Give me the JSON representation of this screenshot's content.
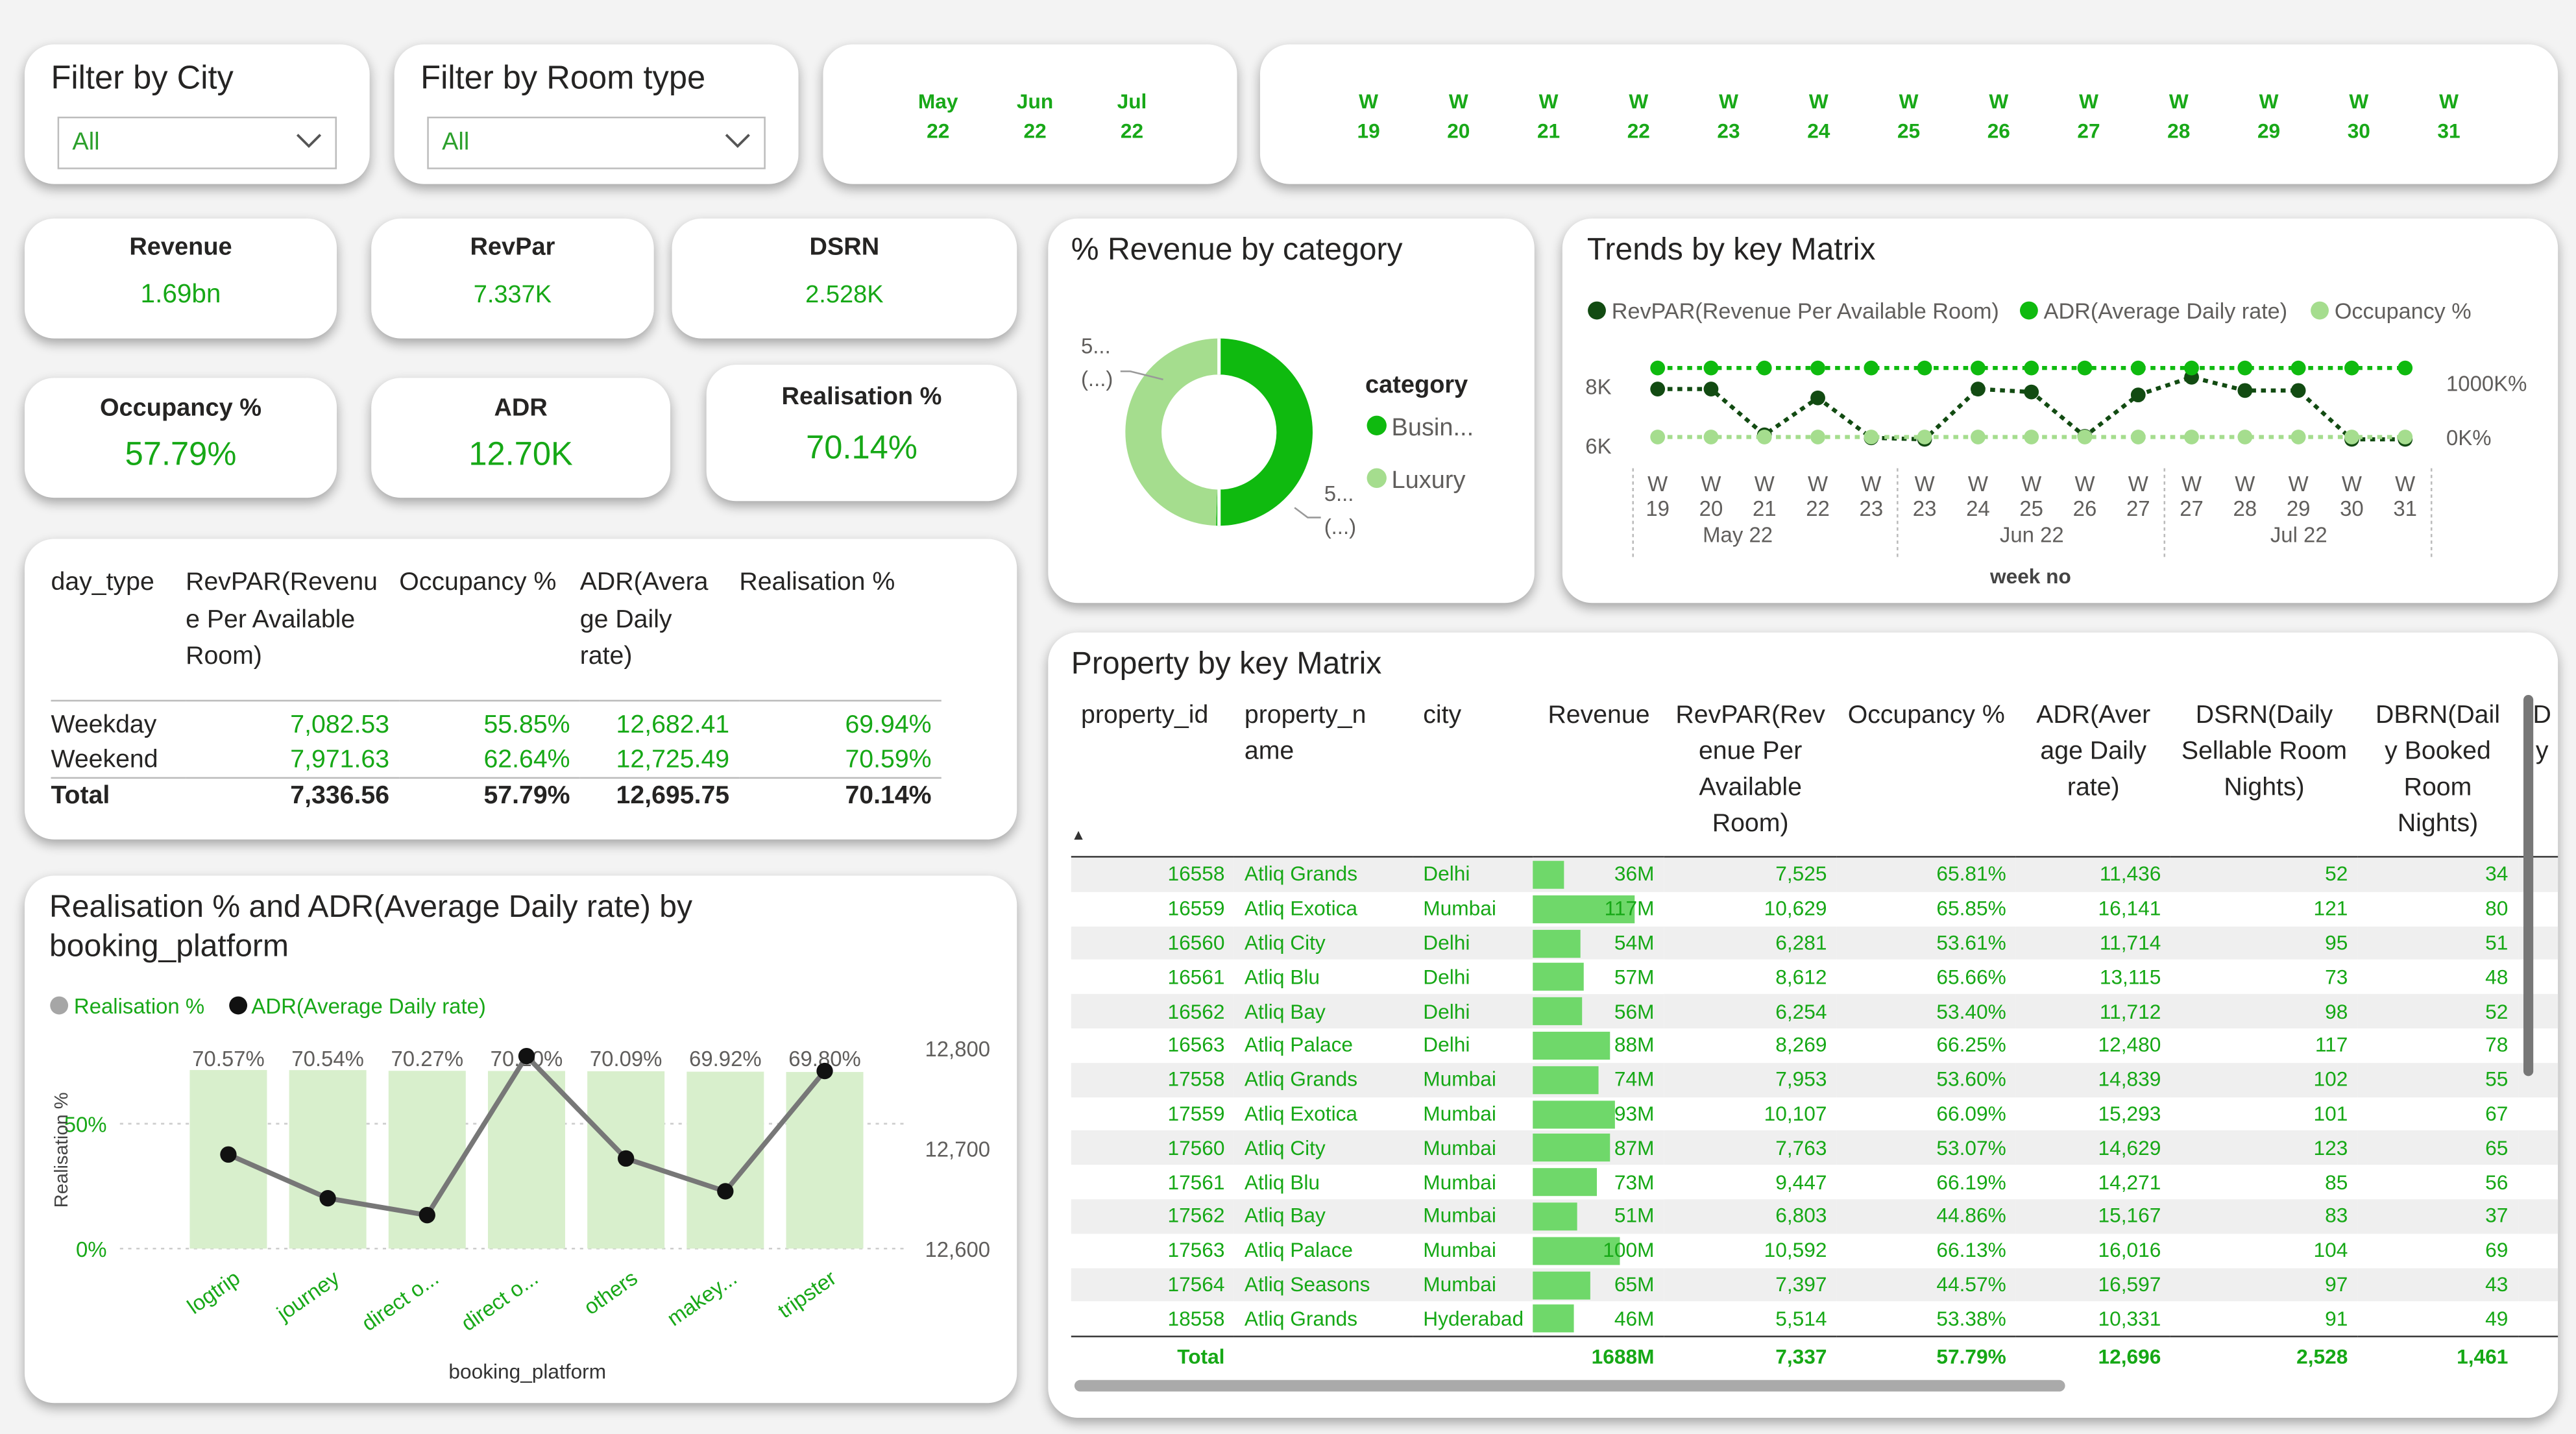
{
  "colors": {
    "dark_green": "#124b12",
    "mid_green": "#0fba0f",
    "light_green": "#a5dd8e",
    "bar_fill": "#d8efcc",
    "data_bar": "#6fd86a",
    "line_gray": "#777777"
  },
  "filters": {
    "city": {
      "title": "Filter by City",
      "value": "All"
    },
    "room_type": {
      "title": "Filter by Room type",
      "value": "All"
    }
  },
  "month_slicer": [
    {
      "top": "May",
      "bottom": "22"
    },
    {
      "top": "Jun",
      "bottom": "22"
    },
    {
      "top": "Jul",
      "bottom": "22"
    }
  ],
  "week_slicer": [
    {
      "top": "W",
      "bottom": "19"
    },
    {
      "top": "W",
      "bottom": "20"
    },
    {
      "top": "W",
      "bottom": "21"
    },
    {
      "top": "W",
      "bottom": "22"
    },
    {
      "top": "W",
      "bottom": "23"
    },
    {
      "top": "W",
      "bottom": "24"
    },
    {
      "top": "W",
      "bottom": "25"
    },
    {
      "top": "W",
      "bottom": "26"
    },
    {
      "top": "W",
      "bottom": "27"
    },
    {
      "top": "W",
      "bottom": "28"
    },
    {
      "top": "W",
      "bottom": "29"
    },
    {
      "top": "W",
      "bottom": "30"
    },
    {
      "top": "W",
      "bottom": "31"
    }
  ],
  "kpis": {
    "revenue": {
      "label": "Revenue",
      "value": "1.69bn"
    },
    "revpar": {
      "label": "RevPar",
      "value": "7.337K"
    },
    "dsrn": {
      "label": "DSRN",
      "value": "2.528K"
    },
    "occupancy": {
      "label": "Occupancy %",
      "value": "57.79%"
    },
    "adr": {
      "label": "ADR",
      "value": "12.70K"
    },
    "realisation": {
      "label": "Realisation %",
      "value": "70.14%"
    }
  },
  "day_type_table": {
    "headers": [
      "day_type",
      "RevPAR(Revenu e Per Available Room)",
      "Occupancy %",
      "ADR(Avera ge Daily rate)",
      "Realisation %"
    ],
    "header_lines": [
      [
        "day_type"
      ],
      [
        "RevPAR(Revenu",
        "e Per Available",
        "Room)"
      ],
      [
        "Occupancy %"
      ],
      [
        "ADR(Avera",
        "ge Daily",
        "rate)"
      ],
      [
        "Realisation %"
      ]
    ],
    "rows": [
      [
        "Weekday",
        "7,082.53",
        "55.85%",
        "12,682.41",
        "69.94%"
      ],
      [
        "Weekend",
        "7,971.63",
        "62.64%",
        "12,725.49",
        "70.59%"
      ]
    ],
    "total": [
      "Total",
      "7,336.56",
      "57.79%",
      "12,695.75",
      "70.14%"
    ]
  },
  "donut": {
    "title": "% Revenue by category",
    "legend_title": "category",
    "legend": [
      "Busin...",
      "Luxury"
    ],
    "label_top": [
      "5...",
      "(...)"
    ],
    "label_bottom": [
      "5...",
      "(...)"
    ]
  },
  "trends": {
    "title": "Trends by key Matrix",
    "legend": [
      "RevPAR(Revenue Per Available Room)",
      "ADR(Average Daily rate)",
      "Occupancy %"
    ],
    "y_left": [
      "8K",
      "6K"
    ],
    "y_right": [
      "1000K%",
      "0K%"
    ],
    "month_labels": [
      "May 22",
      "Jun 22",
      "Jul 22"
    ],
    "xlabel": "week no"
  },
  "realisation_chart": {
    "title": "Realisation % and ADR(Average Daily rate) by booking_platform",
    "legend": [
      "Realisation %",
      "ADR(Average Daily rate)"
    ],
    "ylabel": "Realisation %",
    "xlabel": "booking_platform",
    "y_left_ticks": [
      "50%",
      "0%"
    ],
    "y_right_ticks": [
      "12,800",
      "12,700",
      "12,600"
    ],
    "bar_labels": [
      "70.57%",
      "70.54%",
      "70.27%",
      "70.20%",
      "70.09%",
      "69.92%",
      "69.80%"
    ]
  },
  "property_table": {
    "title": "Property by key Matrix",
    "header_lines": [
      [
        "property_id"
      ],
      [
        "property_n",
        "ame"
      ],
      [
        "city"
      ],
      [
        "Revenue"
      ],
      [
        "RevPAR(Rev",
        "enue Per",
        "Available",
        "Room)"
      ],
      [
        "Occupancy %"
      ],
      [
        "ADR(Aver",
        "age Daily",
        "rate)"
      ],
      [
        "DSRN(Daily",
        "Sellable Room",
        "Nights)"
      ],
      [
        "DBRN(Dail",
        "y Booked",
        "Room",
        "Nights)"
      ],
      [
        "D",
        "y"
      ]
    ],
    "rows": [
      [
        "16558",
        "Atliq Grands",
        "Delhi",
        "36M",
        "7,525",
        "65.81%",
        "11,436",
        "52",
        "34"
      ],
      [
        "16559",
        "Atliq Exotica",
        "Mumbai",
        "117M",
        "10,629",
        "65.85%",
        "16,141",
        "121",
        "80"
      ],
      [
        "16560",
        "Atliq City",
        "Delhi",
        "54M",
        "6,281",
        "53.61%",
        "11,714",
        "95",
        "51"
      ],
      [
        "16561",
        "Atliq Blu",
        "Delhi",
        "57M",
        "8,612",
        "65.66%",
        "13,115",
        "73",
        "48"
      ],
      [
        "16562",
        "Atliq Bay",
        "Delhi",
        "56M",
        "6,254",
        "53.40%",
        "11,712",
        "98",
        "52"
      ],
      [
        "16563",
        "Atliq Palace",
        "Delhi",
        "88M",
        "8,269",
        "66.25%",
        "12,480",
        "117",
        "78"
      ],
      [
        "17558",
        "Atliq Grands",
        "Mumbai",
        "74M",
        "7,953",
        "53.60%",
        "14,839",
        "102",
        "55"
      ],
      [
        "17559",
        "Atliq Exotica",
        "Mumbai",
        "93M",
        "10,107",
        "66.09%",
        "15,293",
        "101",
        "67"
      ],
      [
        "17560",
        "Atliq City",
        "Mumbai",
        "87M",
        "7,763",
        "53.07%",
        "14,629",
        "123",
        "65"
      ],
      [
        "17561",
        "Atliq Blu",
        "Mumbai",
        "73M",
        "9,447",
        "66.19%",
        "14,271",
        "85",
        "56"
      ],
      [
        "17562",
        "Atliq Bay",
        "Mumbai",
        "51M",
        "6,803",
        "44.86%",
        "15,167",
        "83",
        "37"
      ],
      [
        "17563",
        "Atliq Palace",
        "Mumbai",
        "100M",
        "10,592",
        "66.13%",
        "16,016",
        "104",
        "69"
      ],
      [
        "17564",
        "Atliq Seasons",
        "Mumbai",
        "65M",
        "7,397",
        "44.57%",
        "16,597",
        "97",
        "43"
      ],
      [
        "18558",
        "Atliq Grands",
        "Hyderabad",
        "46M",
        "5,514",
        "53.38%",
        "10,331",
        "91",
        "49"
      ]
    ],
    "total": [
      "Total",
      "",
      "",
      "1688M",
      "7,337",
      "57.79%",
      "12,696",
      "2,528",
      "1,461"
    ]
  },
  "chart_data": [
    {
      "type": "pie",
      "title": "% Revenue by category",
      "categories": [
        "Busin...",
        "Luxury"
      ],
      "values": [
        50.5,
        49.5
      ],
      "legend": "right"
    },
    {
      "type": "line",
      "title": "Trends by key Matrix",
      "x": [
        "W 19",
        "W 20",
        "W 21",
        "W 22",
        "W 23",
        "W 23",
        "W 24",
        "W 25",
        "W 26",
        "W 27",
        "W 27",
        "W 28",
        "W 29",
        "W 30",
        "W 31"
      ],
      "series": [
        {
          "name": "RevPAR(Revenue Per Available Room)",
          "axis": "left",
          "values": [
            7900,
            7900,
            6350,
            7600,
            6250,
            6200,
            7900,
            7800,
            6300,
            7700,
            8300,
            7850,
            7850,
            6200,
            6200
          ]
        },
        {
          "name": "ADR(Average Daily rate)",
          "axis": "left",
          "values": [
            8300,
            8300,
            8300,
            8300,
            8300,
            8300,
            8300,
            8300,
            8300,
            8300,
            8300,
            8300,
            8300,
            8300,
            8300
          ]
        },
        {
          "name": "Occupancy %",
          "axis": "right",
          "values": [
            0,
            0,
            0,
            0,
            0,
            0,
            0,
            0,
            0,
            0,
            0,
            0,
            0,
            0,
            0
          ]
        }
      ],
      "xlabel": "week no",
      "legend": "top"
    },
    {
      "type": "bar",
      "title": "Realisation % and ADR(Average Daily rate) by booking_platform",
      "categories": [
        "logtrip",
        "journey",
        "direct o...",
        "direct o...",
        "others",
        "makey...",
        "tripster"
      ],
      "series": [
        {
          "name": "Realisation %",
          "kind": "bar",
          "axis": "left",
          "values": [
            70.57,
            70.54,
            70.27,
            70.2,
            70.09,
            69.92,
            69.8
          ]
        },
        {
          "name": "ADR(Average Daily rate)",
          "kind": "line",
          "axis": "right",
          "values": [
            12693,
            12649,
            12632,
            12792,
            12689,
            12656,
            12777
          ]
        }
      ],
      "ylim_left": [
        0,
        100
      ],
      "ylim_right": [
        12600,
        12800
      ],
      "xlabel": "booking_platform",
      "ylabel": "Realisation %",
      "legend": "top-left"
    }
  ]
}
